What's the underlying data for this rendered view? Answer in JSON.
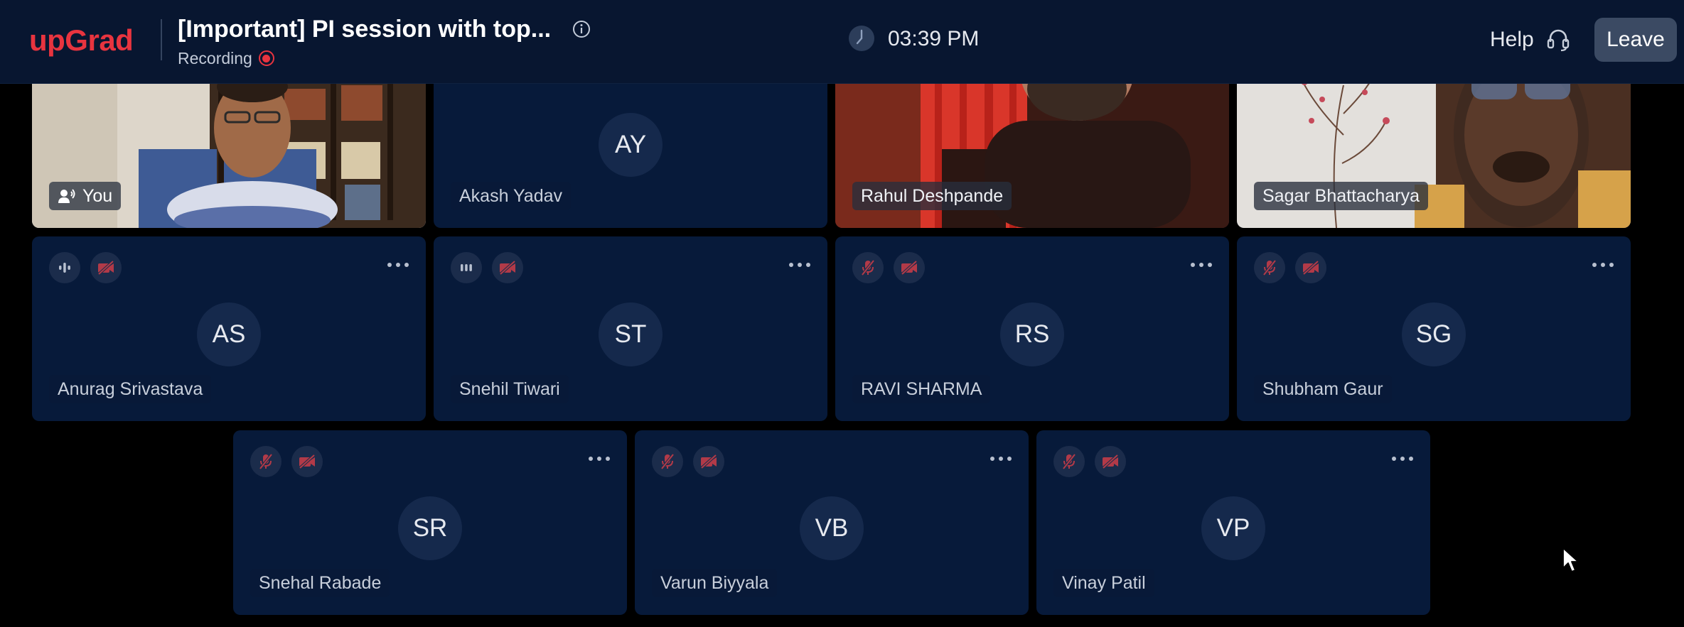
{
  "header": {
    "logo": "upGrad",
    "title": "[Important] PI session with top...",
    "recording_label": "Recording",
    "time": "03:39 PM",
    "help_label": "Help",
    "leave_label": "Leave"
  },
  "participants": [
    {
      "name": "You",
      "initials": ""
    },
    {
      "name": "Akash Yadav",
      "initials": "AY"
    },
    {
      "name": "Rahul Deshpande",
      "initials": ""
    },
    {
      "name": "Sagar Bhattacharya",
      "initials": ""
    },
    {
      "name": "Anurag Srivastava",
      "initials": "AS"
    },
    {
      "name": "Snehil Tiwari",
      "initials": "ST"
    },
    {
      "name": "RAVI SHARMA",
      "initials": "RS"
    },
    {
      "name": "Shubham Gaur",
      "initials": "SG"
    },
    {
      "name": "Snehal Rabade",
      "initials": "SR"
    },
    {
      "name": "Varun Biyyala",
      "initials": "VB"
    },
    {
      "name": "Vinay Patil",
      "initials": "VP"
    }
  ],
  "colors": {
    "brand": "#e8343f",
    "header_bg": "#081630",
    "tile_bg": "#071a3a",
    "muted_icon": "#b23a48"
  },
  "icons": {
    "info": "info-icon",
    "recording": "recording-dot-icon",
    "clock": "clock-icon",
    "help": "headset-icon",
    "mic_muted": "mic-muted-icon",
    "camera_off": "camera-off-icon",
    "audio_level": "audio-level-icon",
    "more": "more-options-icon",
    "cursor": "mouse-cursor-icon"
  }
}
